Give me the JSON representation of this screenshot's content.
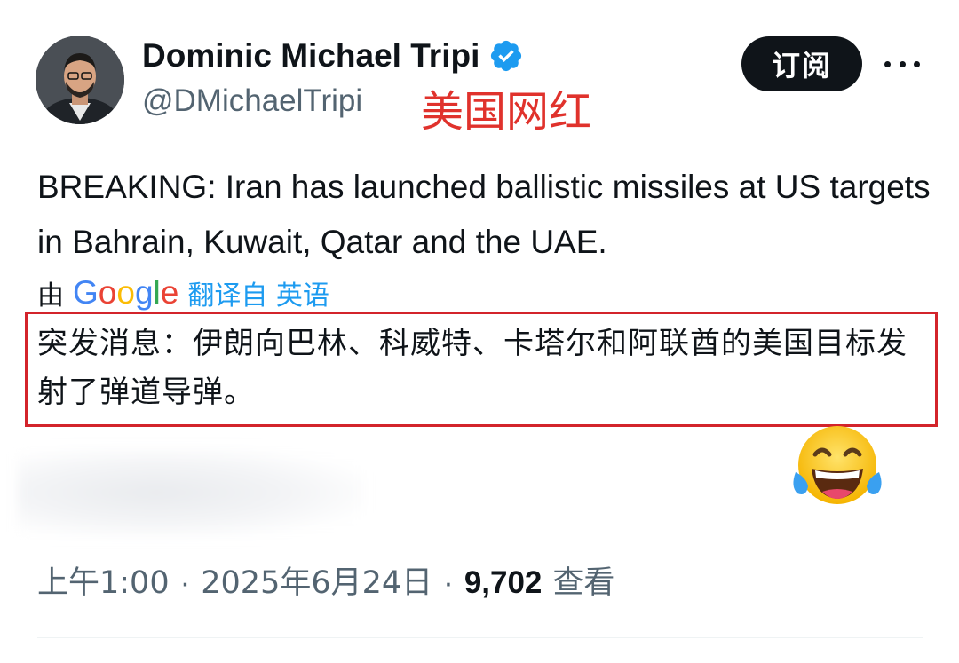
{
  "author": {
    "display_name": "Dominic Michael Tripi",
    "handle": "@DMichaelTripi",
    "verified": true,
    "annotation": "美国网红"
  },
  "header": {
    "subscribe_label": "订阅",
    "more_icon": "more-horizontal-icon"
  },
  "tweet": {
    "text": "BREAKING: Iran has launched ballistic missiles at US targets in Bahrain, Kuwait, Qatar and the UAE.",
    "translated_by_prefix": "由",
    "translated_by_brand": "Google",
    "translated_by_suffix": "翻译自 英语",
    "translation": "突发消息：伊朗向巴林、科威特、卡塔尔和阿联酋的美国目标发射了弹道导弹。"
  },
  "meta": {
    "time": "上午1:00",
    "separator": "·",
    "date": "2025年6月24日",
    "views": "9,702",
    "views_label": "查看"
  },
  "colors": {
    "accent": "#1d9bf0",
    "annotation_red": "#e0322c",
    "box_red": "#d3242b",
    "text_primary": "#0f1419",
    "text_secondary": "#536471"
  },
  "emoji": "face-with-tears-of-joy"
}
